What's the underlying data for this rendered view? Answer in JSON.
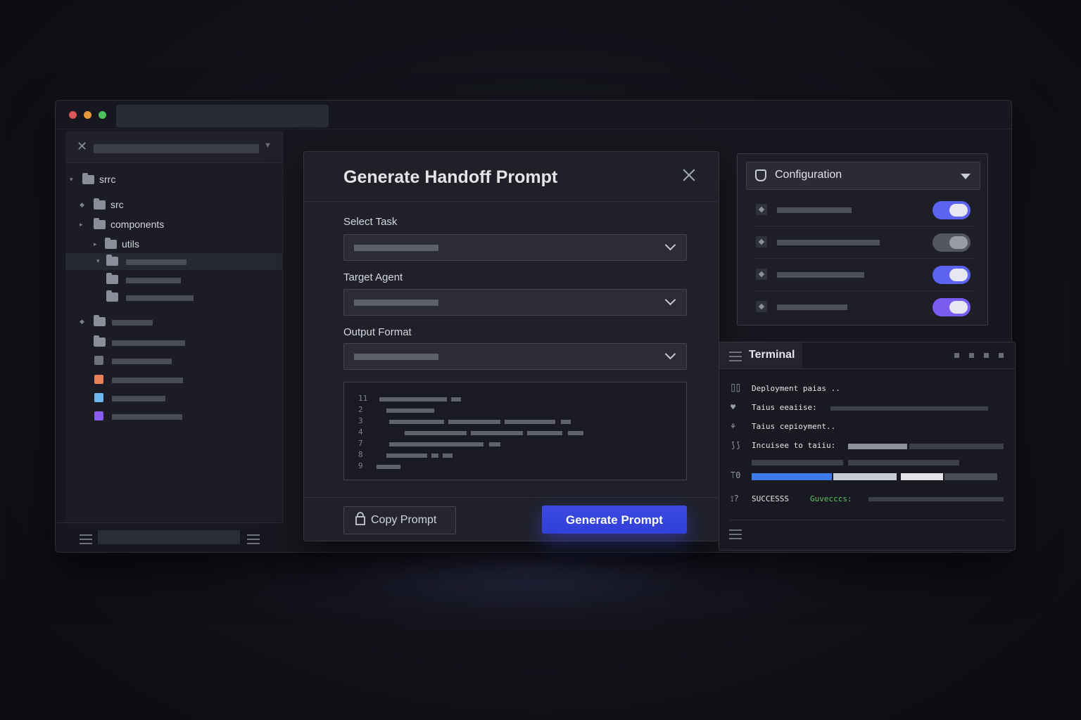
{
  "sidebar": {
    "root_label": "srrc",
    "items": [
      {
        "label": "src"
      },
      {
        "label": "components"
      },
      {
        "label": "utils"
      }
    ]
  },
  "modal": {
    "title": "Generate Handoff Prompt",
    "fields": [
      {
        "label": "Select Task"
      },
      {
        "label": "Target Agent"
      },
      {
        "label": "Output Format"
      }
    ],
    "code_line_numbers": [
      "11",
      "2",
      "3",
      "4",
      "7",
      "8",
      "9"
    ],
    "copy_button": "Copy Prompt",
    "generate_button": "Generate Prompt"
  },
  "config": {
    "title": "Configuration",
    "toggles": [
      {
        "on": true,
        "color": "#5b63f0"
      },
      {
        "on": false,
        "color": "#54565f"
      },
      {
        "on": true,
        "color": "#5b63f0"
      },
      {
        "on": true,
        "color": "#7a5cf0"
      }
    ]
  },
  "terminal": {
    "title": "Terminal",
    "lines": [
      {
        "glyph": "⌷⌷",
        "text": "Deployment paias .."
      },
      {
        "glyph": "♥",
        "text": "Taius eeaiise:"
      },
      {
        "glyph": "⚘",
        "text": "Taius cepioyment.."
      },
      {
        "glyph": "⟆⟆",
        "text": "Incuisee to taiiu:"
      },
      {
        "glyph": "⟙0",
        "text": ""
      },
      {
        "glyph": "⟟?",
        "text": "SUCCESSS",
        "status": "Guvecccs:"
      }
    ]
  },
  "colors": {
    "accent": "#3b49e0",
    "success": "#58c46a",
    "toggle_on": "#5b63f0"
  }
}
